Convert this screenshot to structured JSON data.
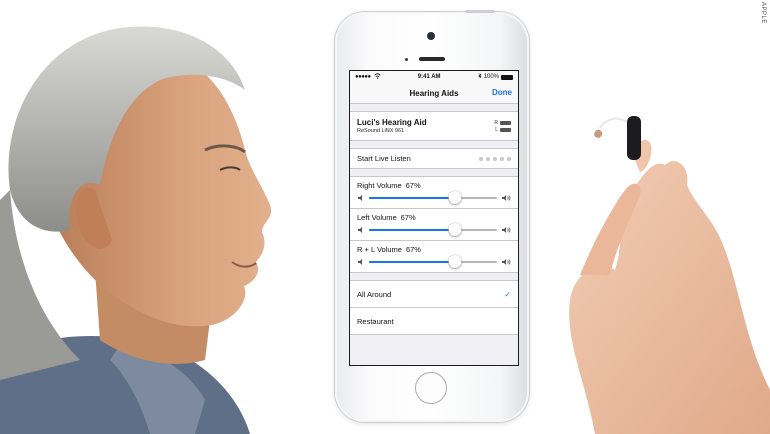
{
  "credit": "APPLE",
  "status_bar": {
    "carrier_icon": "signal-dots",
    "time": "9:41 AM",
    "bluetooth_icon": "bluetooth-icon",
    "battery": "100%"
  },
  "nav": {
    "title": "Hearing Aids",
    "done": "Done"
  },
  "device": {
    "name": "Luci's Hearing Aid",
    "model": "ReSound LiNX 961",
    "right_label": "R",
    "left_label": "L"
  },
  "live_listen": {
    "label": "Start Live Listen"
  },
  "volumes": [
    {
      "label": "Right Volume",
      "value": "67%",
      "level": 0.67
    },
    {
      "label": "Left Volume",
      "value": "67%",
      "level": 0.67
    },
    {
      "label": "R + L Volume",
      "value": "67%",
      "level": 0.67
    }
  ],
  "environments": [
    {
      "label": "All Around",
      "selected": true
    },
    {
      "label": "Restaurant",
      "selected": false
    }
  ],
  "colors": {
    "accent": "#1a73e8",
    "background": "#efeff4"
  }
}
